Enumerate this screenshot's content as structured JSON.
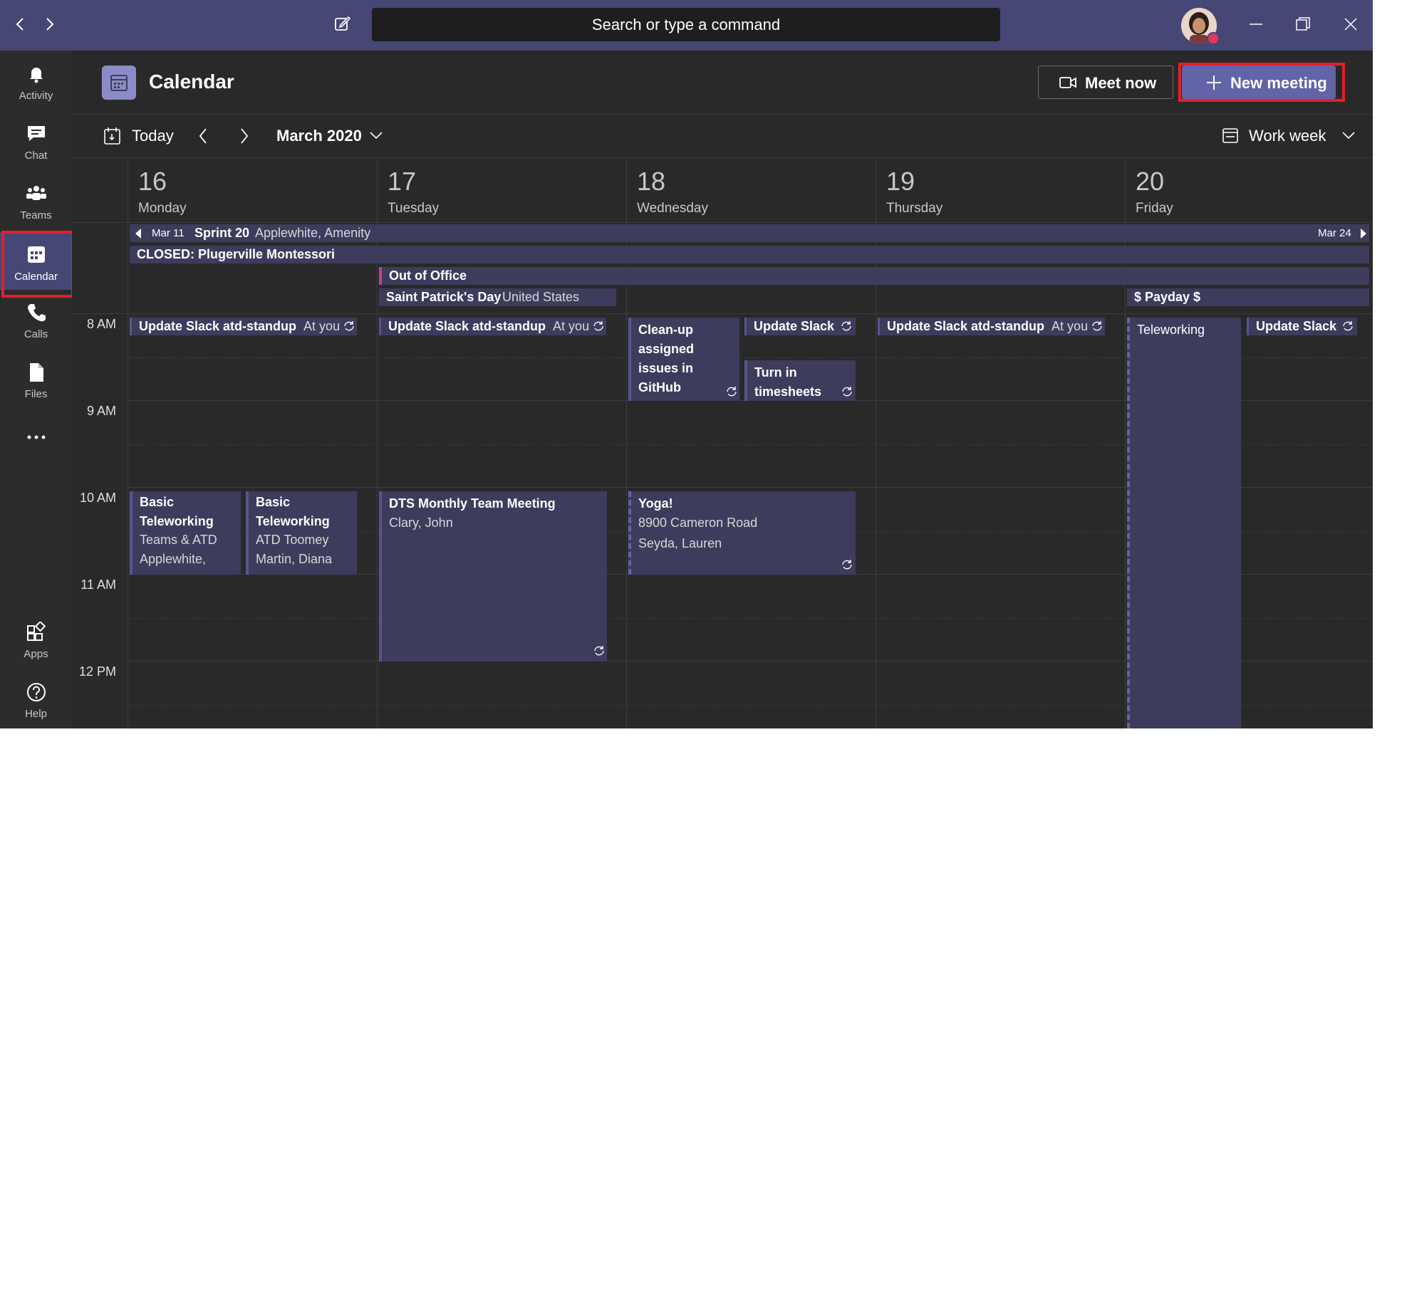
{
  "titlebar": {
    "search_placeholder": "Search or type a command",
    "nav_back_icon": "chevron-left-icon",
    "nav_forward_icon": "chevron-right-icon",
    "compose_icon": "compose-icon",
    "window_controls": [
      "minimize-icon",
      "restore-icon",
      "close-icon"
    ],
    "background_color": "#464775"
  },
  "rail": {
    "items": [
      {
        "label": "Activity",
        "icon": "bell-icon"
      },
      {
        "label": "Chat",
        "icon": "chat-icon"
      },
      {
        "label": "Teams",
        "icon": "teams-icon"
      },
      {
        "label": "Calendar",
        "icon": "calendar-icon",
        "active": true
      },
      {
        "label": "Calls",
        "icon": "phone-icon"
      },
      {
        "label": "Files",
        "icon": "file-icon"
      }
    ],
    "more_icon": "more-icon",
    "bottom_items": [
      {
        "label": "Apps",
        "icon": "apps-icon"
      },
      {
        "label": "Help",
        "icon": "help-icon"
      }
    ]
  },
  "header": {
    "title": "Calendar",
    "meet_now_label": "Meet now",
    "new_meeting_label": "New meeting",
    "accent_color": "#6264a7",
    "highlight_color": "#e61e2c"
  },
  "toolbar": {
    "today_label": "Today",
    "month_label": "March 2020",
    "view_label": "Work week"
  },
  "days": [
    {
      "num": "16",
      "name": "Monday"
    },
    {
      "num": "17",
      "name": "Tuesday"
    },
    {
      "num": "18",
      "name": "Wednesday"
    },
    {
      "num": "19",
      "name": "Thursday"
    },
    {
      "num": "20",
      "name": "Friday"
    }
  ],
  "times": [
    "8 AM",
    "9 AM",
    "10 AM",
    "11 AM",
    "12 PM"
  ],
  "allday": {
    "sprint": {
      "start": "Mar 11",
      "title": "Sprint 20",
      "people": "Applewhite, Amenity",
      "end": "Mar 24"
    },
    "closed": "CLOSED: Plugerville Montessori",
    "ooo": "Out of Office",
    "stpat": {
      "title": "Saint Patrick's Day",
      "sub": "United States"
    },
    "payday": "$ Payday $"
  },
  "events": {
    "standup_title": "Update Slack atd-standup",
    "standup_sub": "At you",
    "update_slack": "Update Slack",
    "cleanup": "Clean-up assigned issues in GitHub",
    "timesheets": "Turn in timesheets",
    "teleworking": "Teleworking",
    "basic1": {
      "title": "Basic Teleworking",
      "line1": "Teams & ATD",
      "line2": "Applewhite,"
    },
    "basic2": {
      "title": "Basic Teleworking",
      "line1": "ATD Toomey",
      "line2": "Martin, Diana"
    },
    "dts": {
      "title": "DTS Monthly Team Meeting",
      "sub": "Clary, John"
    },
    "yoga": {
      "title": "Yoga!",
      "line1": "8900 Cameron Road",
      "line2": "Seyda, Lauren"
    }
  }
}
